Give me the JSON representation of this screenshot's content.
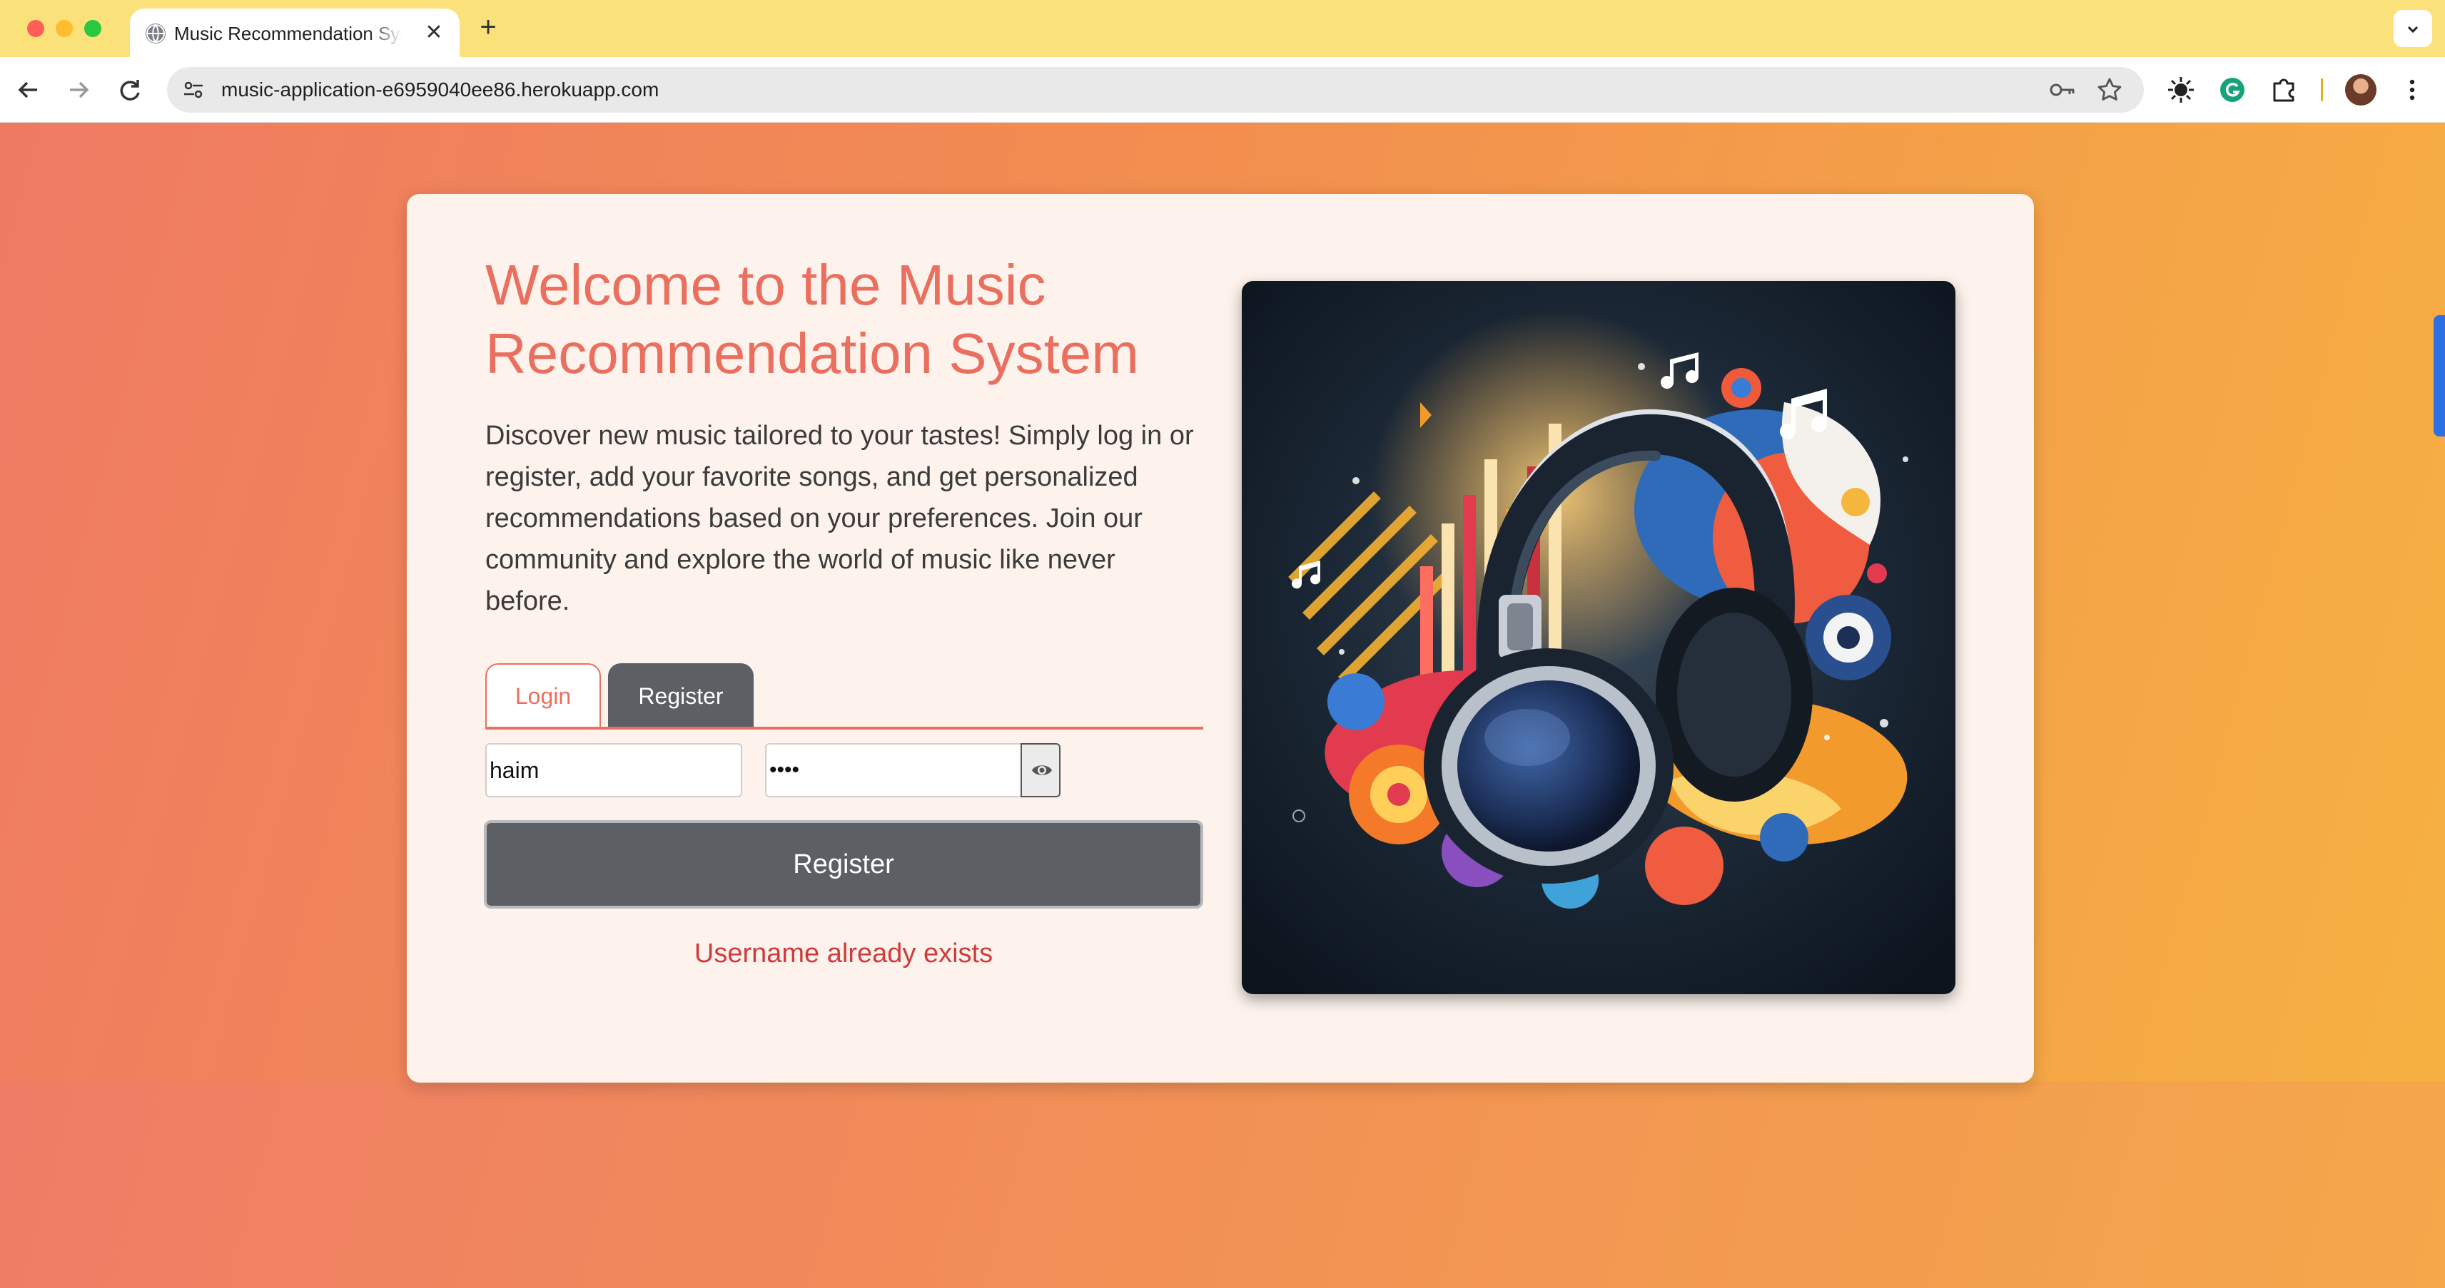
{
  "browser": {
    "tab_title": "Music Recommendation System",
    "url": "music-application-e6959040ee86.herokuapp.com",
    "tab_close_glyph": "✕",
    "new_tab_glyph": "+",
    "icons": [
      "globe-icon",
      "close-icon",
      "plus-icon",
      "chevron-down-icon",
      "back-arrow-icon",
      "forward-arrow-icon",
      "reload-icon",
      "site-settings-icon",
      "key-icon",
      "star-icon",
      "extension-sun-icon",
      "grammarly-icon",
      "puzzle-icon",
      "profile-avatar",
      "more-vert-icon"
    ]
  },
  "page": {
    "title": "Welcome to the Music Recommendation System",
    "intro": "Discover new music tailored to your tastes! Simply log in or register, add your favorite songs, and get personalized recommendations based on your preferences. Join our community and explore the world of music like never before.",
    "tabs": {
      "login_label": "Login",
      "register_label": "Register",
      "active": "Register"
    },
    "form": {
      "username_value": "haim",
      "password_value": "haim",
      "password_masked": true,
      "submit_label": "Register"
    },
    "error": "Username already exists",
    "hero_image": "headphones-music-illustration"
  },
  "colors": {
    "accent": "#ea6f5e",
    "button_dark": "#5c5f63",
    "error": "#d13a3a",
    "card_bg": "#fdf3ec",
    "tab_strip": "#fae17a",
    "bg_gradient_start": "#ef7a63",
    "bg_gradient_end": "#f6b241"
  }
}
